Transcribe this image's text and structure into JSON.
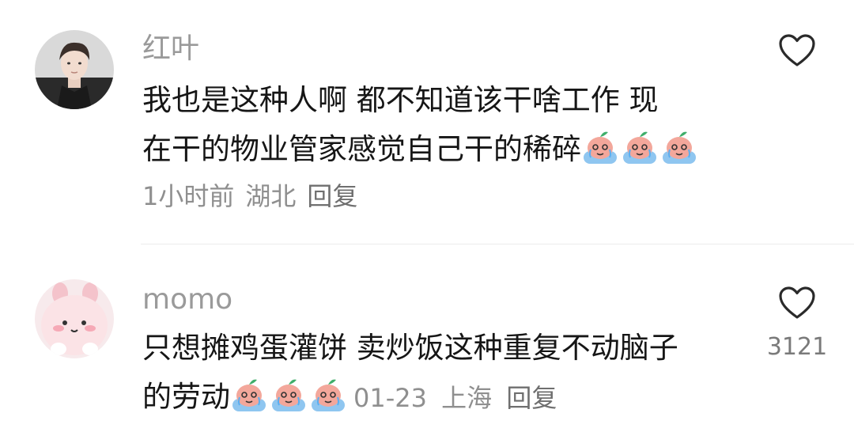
{
  "comments": [
    {
      "username": "红叶",
      "line1": "我也是这种人啊  都不知道该干啥工作  现",
      "line2": "在干的物业管家感觉自己干的稀碎",
      "emoji_icon": "crying-peach-emoji",
      "time": "1小时前",
      "location": "湖北",
      "reply_label": "回复",
      "like_count": ""
    },
    {
      "username": "momo",
      "line1": "只想摊鸡蛋灌饼 卖炒饭这种重复不动脑子",
      "line2": "的劳动",
      "emoji_icon": "crying-peach-emoji",
      "time": "01-23",
      "location": "上海",
      "reply_label": "回复",
      "like_count": "3121"
    }
  ],
  "colors": {
    "username": "#9a9a9a",
    "text": "#161616",
    "meta": "#8f8f8f",
    "divider": "#ececec",
    "emoji_pink": "#f3a79b",
    "emoji_blue": "#8fc6f0"
  }
}
